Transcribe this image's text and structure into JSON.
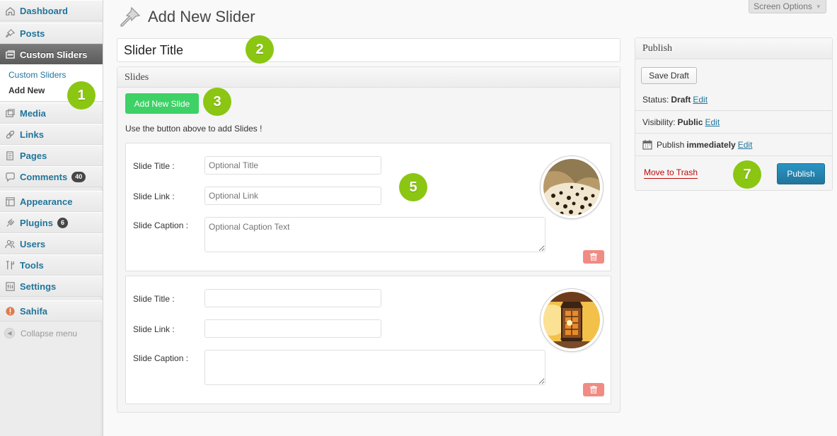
{
  "sidebar": {
    "items": [
      {
        "label": "Dashboard",
        "icon": "dashboard-icon"
      },
      {
        "label": "Posts",
        "icon": "pushpin-icon"
      },
      {
        "label": "Custom Sliders",
        "icon": "sliders-icon",
        "active": true
      },
      {
        "label": "Media",
        "icon": "media-icon"
      },
      {
        "label": "Links",
        "icon": "links-icon"
      },
      {
        "label": "Pages",
        "icon": "pages-icon"
      },
      {
        "label": "Comments",
        "icon": "comments-icon",
        "badge": "40"
      },
      {
        "label": "Appearance",
        "icon": "appearance-icon"
      },
      {
        "label": "Plugins",
        "icon": "plugins-icon",
        "badge": "6"
      },
      {
        "label": "Users",
        "icon": "users-icon"
      },
      {
        "label": "Tools",
        "icon": "tools-icon"
      },
      {
        "label": "Settings",
        "icon": "settings-icon"
      },
      {
        "label": "Sahifa",
        "icon": "sahifa-icon"
      }
    ],
    "submenu": [
      "Custom Sliders",
      "Add New"
    ],
    "collapse_label": "Collapse menu"
  },
  "header": {
    "screen_options": "Screen Options",
    "title": "Add New Slider"
  },
  "title_input": {
    "value": "Slider Title"
  },
  "slides_box": {
    "heading": "Slides",
    "add_button": "Add New Slide",
    "hint": "Use the button above to add Slides !",
    "labels": {
      "title": "Slide Title :",
      "link": "Slide Link :",
      "caption": "Slide Caption :"
    },
    "slides": [
      {
        "title_placeholder": "Optional Title",
        "link_placeholder": "Optional Link",
        "caption_placeholder": "Optional Caption Text"
      },
      {
        "title_placeholder": "",
        "link_placeholder": "",
        "caption_placeholder": ""
      }
    ]
  },
  "publish": {
    "heading": "Publish",
    "save_draft": "Save Draft",
    "status_label": "Status:",
    "status_value": "Draft",
    "visibility_label": "Visibility:",
    "visibility_value": "Public",
    "publish_label": "Publish",
    "publish_value": "immediately",
    "edit_label": "Edit",
    "trash_label": "Move to Trash",
    "publish_button": "Publish"
  },
  "markers": [
    "1",
    "2",
    "3",
    "5",
    "7"
  ],
  "colors": {
    "marker_green": "#8bc613",
    "add_slide_green": "#3dd166",
    "link_blue": "#21759b",
    "trash_red": "#bc0b0b",
    "delete_pink": "#f08c84"
  }
}
